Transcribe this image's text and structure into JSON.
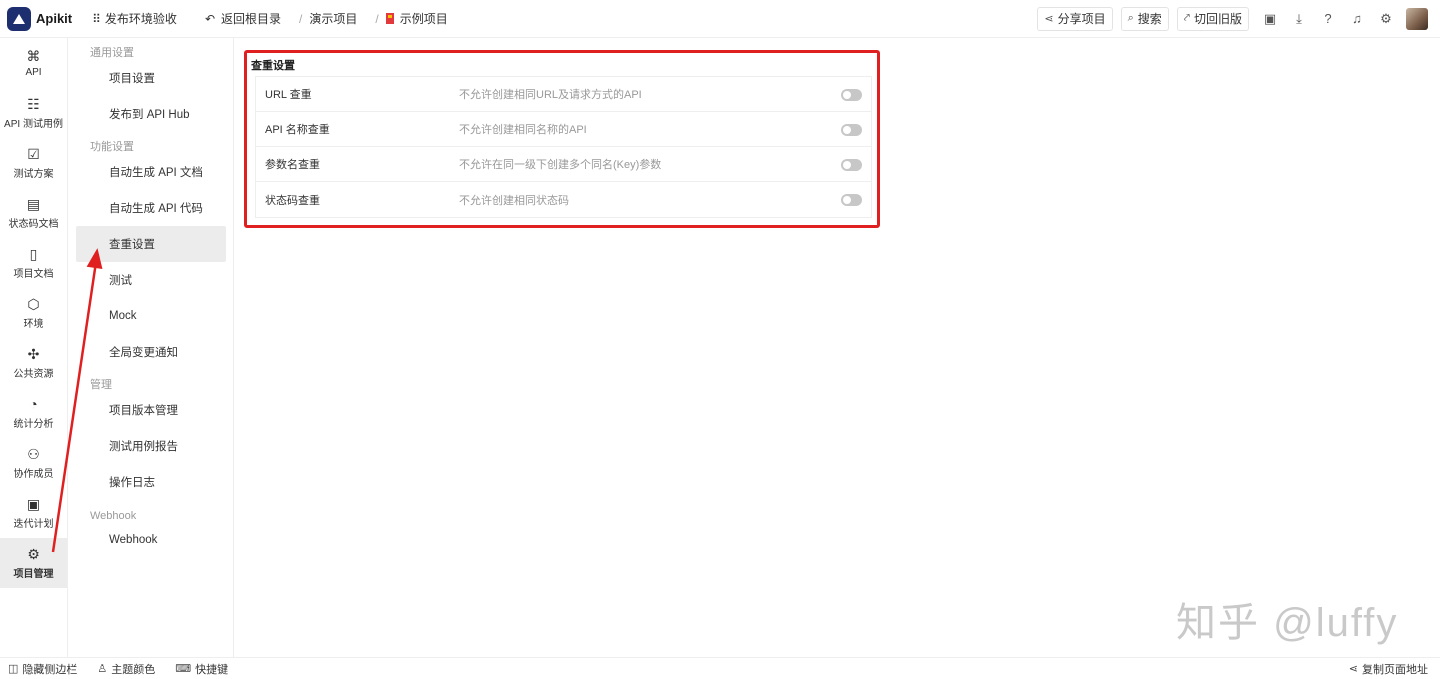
{
  "app": {
    "brand": "Apikit",
    "env_label": "发布环境验收"
  },
  "breadcrumb": {
    "back_label": "返回根目录",
    "items": [
      "演示项目",
      "示例项目"
    ]
  },
  "topbar": {
    "share_label": "分享项目",
    "search_label": "搜索",
    "old_version_label": "切回旧版"
  },
  "left_nav": [
    {
      "label": "API",
      "icon": "api-icon"
    },
    {
      "label": "API 测试用例",
      "icon": "test-case-icon"
    },
    {
      "label": "测试方案",
      "icon": "test-plan-icon"
    },
    {
      "label": "状态码文档",
      "icon": "status-code-icon"
    },
    {
      "label": "项目文档",
      "icon": "project-doc-icon"
    },
    {
      "label": "环境",
      "icon": "environment-icon"
    },
    {
      "label": "公共资源",
      "icon": "puzzle-icon"
    },
    {
      "label": "统计分析",
      "icon": "pie-chart-icon"
    },
    {
      "label": "协作成员",
      "icon": "members-icon"
    },
    {
      "label": "迭代计划",
      "icon": "calendar-check-icon"
    },
    {
      "label": "项目管理",
      "icon": "gear-icon",
      "active": true
    }
  ],
  "sub_nav": {
    "general_title": "通用设置",
    "general_items": [
      "项目设置",
      "发布到 API Hub"
    ],
    "feature_title": "功能设置",
    "feature_items": [
      "自动生成 API 文档",
      "自动生成 API 代码",
      "查重设置",
      "测试",
      "Mock",
      "全局变更通知"
    ],
    "manage_title": "管理",
    "manage_items": [
      "项目版本管理",
      "测试用例报告",
      "操作日志"
    ],
    "webhook_title": "Webhook",
    "webhook_items": [
      "Webhook"
    ]
  },
  "panel": {
    "title": "查重设置",
    "rows": [
      {
        "name": "URL 查重",
        "desc": "不允许创建相同URL及请求方式的API",
        "enabled": false
      },
      {
        "name": "API 名称查重",
        "desc": "不允许创建相同名称的API",
        "enabled": false
      },
      {
        "name": "参数名查重",
        "desc": "不允许在同一级下创建多个同名(Key)参数",
        "enabled": false
      },
      {
        "name": "状态码查重",
        "desc": "不允许创建相同状态码",
        "enabled": false
      }
    ]
  },
  "watermark": "知乎 @luffy",
  "bottom": {
    "hide_sidebar": "隐藏侧边栏",
    "theme": "主题颜色",
    "shortcuts": "快捷键",
    "copy_url": "复制页面地址"
  },
  "colors": {
    "highlight_red": "#e02020",
    "brand_navy": "#1d2f6e",
    "active_bg": "#ececec"
  }
}
